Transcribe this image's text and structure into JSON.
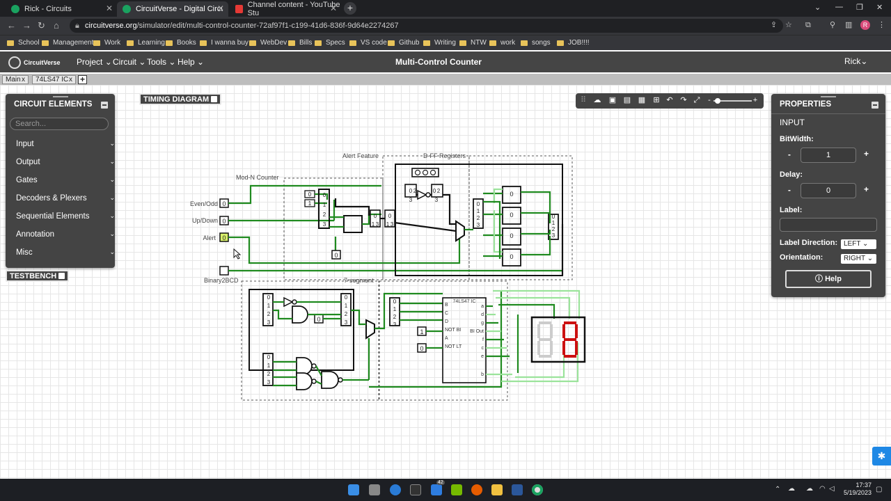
{
  "browser": {
    "tabs": [
      {
        "title": "Rick - Circuits",
        "color": "#1aa260",
        "active": false
      },
      {
        "title": "CircuitVerse - Digital Circuit Sim",
        "color": "#1aa260",
        "active": true
      },
      {
        "title": "Channel content - YouTube Stu",
        "color": "#e53935",
        "active": false
      }
    ],
    "url_host": "circuitverse.org",
    "url_path": "/simulator/edit/multi-control-counter-72af97f1-c199-41d6-836f-9d64e2274267",
    "bookmarks": [
      "School",
      "Management",
      "Work",
      "Learning",
      "Books",
      "I wanna buy",
      "WebDev",
      "Bills",
      "Specs",
      "VS code",
      "Github",
      "Writing",
      "NTW",
      "work",
      "songs",
      "JOB!!!!"
    ],
    "profile_initial": "R"
  },
  "app": {
    "logo": "CircuitVerse",
    "menus": [
      "Project",
      "Circuit",
      "Tools",
      "Help"
    ],
    "title": "Multi-Control Counter",
    "user": "Rick"
  },
  "circuit_tabs": [
    {
      "label": "Main",
      "close": "x"
    },
    {
      "label": "74LS47 IC",
      "close": "x"
    }
  ],
  "elements_panel": {
    "title": "CIRCUIT ELEMENTS",
    "search_placeholder": "Search...",
    "items": [
      "Input",
      "Output",
      "Gates",
      "Decoders & Plexers",
      "Sequential Elements",
      "Annotation",
      "Misc"
    ]
  },
  "timing_diagram": "TIMING DIAGRAM",
  "testbench": "TESTBENCH",
  "properties": {
    "title": "PROPERTIES",
    "element": "INPUT",
    "bitwidth_label": "BitWidth:",
    "bitwidth": "1",
    "delay_label": "Delay:",
    "delay": "0",
    "label_label": "Label:",
    "label_value": "",
    "label_direction_label": "Label Direction:",
    "label_direction": "LEFT",
    "orientation_label": "Orientation:",
    "orientation": "RIGHT",
    "help": "Help",
    "minus": "-",
    "plus": "+"
  },
  "circuit": {
    "inputs": [
      "Even/Odd",
      "Up/Down",
      "Alert",
      "Binary2BCD"
    ],
    "input_values": [
      "0",
      "0",
      "0"
    ],
    "subcircuits": [
      "Mod-N Counter",
      "Alert Feature",
      "D-FF Registers",
      "7-segment"
    ],
    "ic_name": "74LS47 IC",
    "ic_left_pins": [
      "B",
      "C",
      "D",
      "NOT BI",
      "A",
      "NOT LT"
    ],
    "ic_right_pins": [
      "a",
      "d",
      "g",
      "BI Out",
      "f",
      "c",
      "e",
      "b"
    ],
    "ic_inputs": [
      "1",
      "0"
    ],
    "splitter_labels": [
      "0",
      "1",
      "2",
      "3"
    ],
    "ff_values": [
      "0",
      "0",
      "0",
      "0"
    ],
    "alert_bits": [
      "0",
      "2",
      "0",
      "2"
    ],
    "alert_nums": [
      "3",
      "3"
    ],
    "mid_labels": [
      "0",
      "1",
      "3",
      "0",
      "1",
      "3"
    ],
    "const_zero": "0",
    "display_colors": {
      "off": "#cccccc",
      "on": "#cc1111"
    }
  },
  "taskbar": {
    "badge": "42",
    "time": "17:37",
    "date": "5/19/2023"
  }
}
